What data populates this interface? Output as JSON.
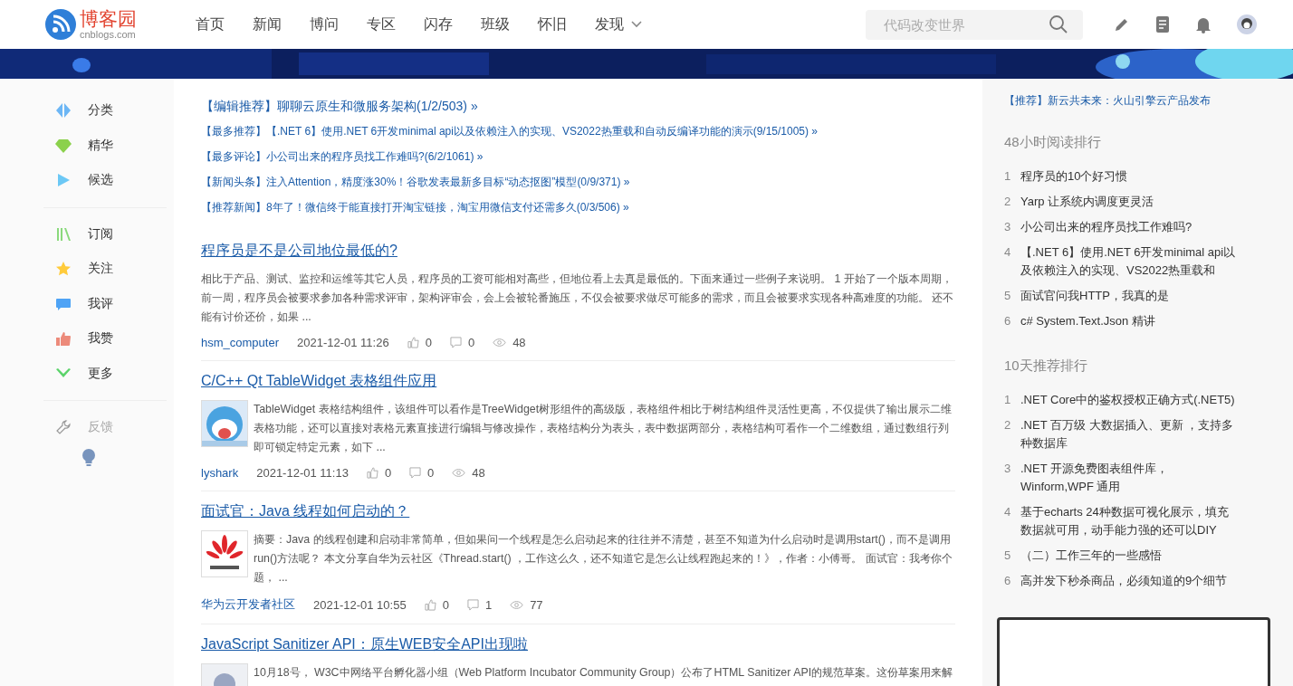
{
  "header": {
    "logo_text": "博客园",
    "logo_domain": "cnblogs.com",
    "nav": [
      {
        "label": "首页",
        "dropdown": false
      },
      {
        "label": "新闻",
        "dropdown": false
      },
      {
        "label": "博问",
        "dropdown": false
      },
      {
        "label": "专区",
        "dropdown": false
      },
      {
        "label": "闪存",
        "dropdown": false
      },
      {
        "label": "班级",
        "dropdown": false
      },
      {
        "label": "怀旧",
        "dropdown": false
      },
      {
        "label": "发现",
        "dropdown": true
      }
    ],
    "search": {
      "placeholder": "代码改变世界"
    }
  },
  "sidebar": {
    "groups": [
      [
        {
          "label": "分类",
          "disabled": false
        },
        {
          "label": "精华",
          "disabled": false
        },
        {
          "label": "候选",
          "disabled": false
        }
      ],
      [
        {
          "label": "订阅",
          "disabled": false
        },
        {
          "label": "关注",
          "disabled": false
        },
        {
          "label": "我评",
          "disabled": false
        },
        {
          "label": "我赞",
          "disabled": false
        },
        {
          "label": "更多",
          "disabled": false
        }
      ],
      [
        {
          "label": "反馈",
          "disabled": true
        }
      ]
    ]
  },
  "headlines": [
    {
      "tag": "【编辑推荐】",
      "title": "聊聊云原生和微服务架构(1/2/503) »",
      "featured": true
    },
    {
      "tag": "【最多推荐】",
      "title": "【.NET 6】使用.NET 6开发minimal api以及依赖注入的实现、VS2022热重载和自动反编译功能的演示(9/15/1005) »",
      "featured": false
    },
    {
      "tag": "【最多评论】",
      "title": "小公司出来的程序员找工作难吗?(6/2/1061) »",
      "featured": false
    },
    {
      "tag": "【新闻头条】",
      "title": "注入Attention，精度涨30%！谷歌发表最新多目标“动态抠图”模型(0/9/371) »",
      "featured": false
    },
    {
      "tag": "【推荐新闻】",
      "title": "8年了！微信终于能直接打开淘宝链接，淘宝用微信支付还需多久(0/3/506) »",
      "featured": false
    }
  ],
  "posts": [
    {
      "title": "程序员是不是公司地位最低的?",
      "summary": "相比于产品、测试、监控和运维等其它人员，程序员的工资可能相对高些，但地位看上去真是最低的。下面来通过一些例子来说明。 1 开始了一个版本周期，前一周，程序员会被要求参加各种需求评审，架构评审会，会上会被轮番施压，不仅会被要求做尽可能多的需求，而且会被要求实现各种高难度的功能。 还不能有讨价还价，如果 ...",
      "author": "hsm_computer",
      "date": "2021-12-01 11:26",
      "likes": "0",
      "comments": "0",
      "views": "48"
    },
    {
      "title": "C/C++ Qt TableWidget 表格组件应用",
      "summary": "TableWidget 表格结构组件，该组件可以看作是TreeWidget树形组件的高级版，表格组件相比于树结构组件灵活性更高，不仅提供了输出展示二维表格功能，还可以直接对表格元素直接进行编辑与修改操作，表格结构分为表头，表中数据两部分，表格结构可看作一个二维数组，通过数组行列即可锁定特定元素，如下 ...",
      "author": "lyshark",
      "date": "2021-12-01 11:13",
      "likes": "0",
      "comments": "0",
      "views": "48"
    },
    {
      "title": "面试官：Java 线程如何启动的？",
      "summary": "摘要：Java 的线程创建和启动非常简单，但如果问一个线程是怎么启动起来的往往并不清楚，甚至不知道为什么启动时是调用start()，而不是调用run()方法呢？ 本文分享自华为云社区《Thread.start() ，工作这么久，还不知道它是怎么让线程跑起来的！》，作者：小傅哥。 面试官：我考你个题， ...",
      "author": "华为云开发者社区",
      "date": "2021-12-01 10:55",
      "likes": "0",
      "comments": "1",
      "views": "77"
    },
    {
      "title": "JavaScript Sanitizer API：原生WEB安全API出现啦",
      "summary": "10月18号， W3C中网络平台孵化器小组（Web Platform Incubator Community Group）公布了HTML Sanitizer API的规范草案。这份草案用来解"
    }
  ],
  "right": {
    "promo": "【推荐】新云共未来：火山引擎云产品发布",
    "rankings": [
      {
        "heading": "48小时阅读排行",
        "items": [
          {
            "num": "1",
            "title": "程序员的10个好习惯"
          },
          {
            "num": "2",
            "title": "Yarp 让系统内调度更灵活"
          },
          {
            "num": "3",
            "title": "小公司出来的程序员找工作难吗?"
          },
          {
            "num": "4",
            "title": "【.NET 6】使用.NET 6开发minimal api以及依赖注入的实现、VS2022热重载和"
          },
          {
            "num": "5",
            "title": "面试官问我HTTP，我真的是"
          },
          {
            "num": "6",
            "title": "c# System.Text.Json 精讲"
          }
        ]
      },
      {
        "heading": "10天推荐排行",
        "items": [
          {
            "num": "1",
            "title": ".NET Core中的鉴权授权正确方式(.NET5)"
          },
          {
            "num": "2",
            "title": ".NET 百万级 大数据插入、更新 ，支持多种数据库"
          },
          {
            "num": "3",
            "title": ".NET 开源免费图表组件库，Winform,WPF 通用"
          },
          {
            "num": "4",
            "title": "基于echarts 24种数据可视化展示，填充数据就可用，动手能力强的还可以DIY"
          },
          {
            "num": "5",
            "title": "（二）工作三年的一些感悟"
          },
          {
            "num": "6",
            "title": "高并发下秒杀商品，必须知道的9个细节"
          }
        ]
      }
    ]
  }
}
